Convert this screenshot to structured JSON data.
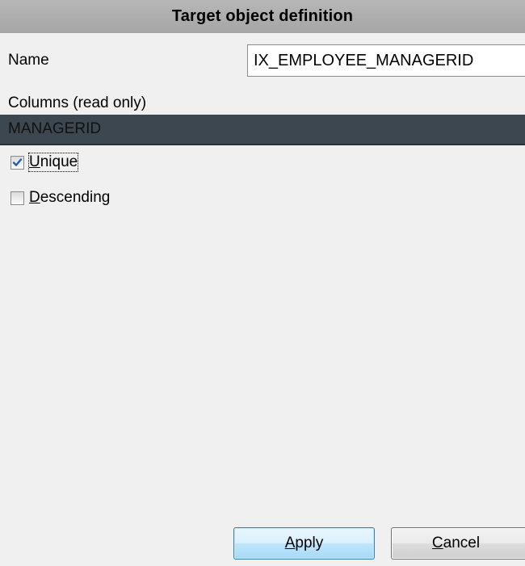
{
  "header": {
    "title": "Target object definition"
  },
  "form": {
    "name_label": "Name",
    "name_value": "IX_EMPLOYEE_MANAGERID",
    "columns_label": "Columns (read only)",
    "columns": [
      "MANAGERID"
    ]
  },
  "options": {
    "unique": {
      "mnemonic": "U",
      "rest": "nique",
      "checked": true
    },
    "descending": {
      "mnemonic": "D",
      "rest": "escending",
      "checked": false
    }
  },
  "buttons": {
    "apply": {
      "mnemonic": "A",
      "rest": "pply"
    },
    "cancel": {
      "mnemonic": "C",
      "rest": "ancel"
    }
  },
  "colors": {
    "header_bg": "#aeaeae",
    "list_selected_bg": "#3c474f",
    "check_mark": "#2d5aa8",
    "apply_border": "#3c7fb1"
  },
  "icons": {
    "check": "checkmark-icon"
  }
}
